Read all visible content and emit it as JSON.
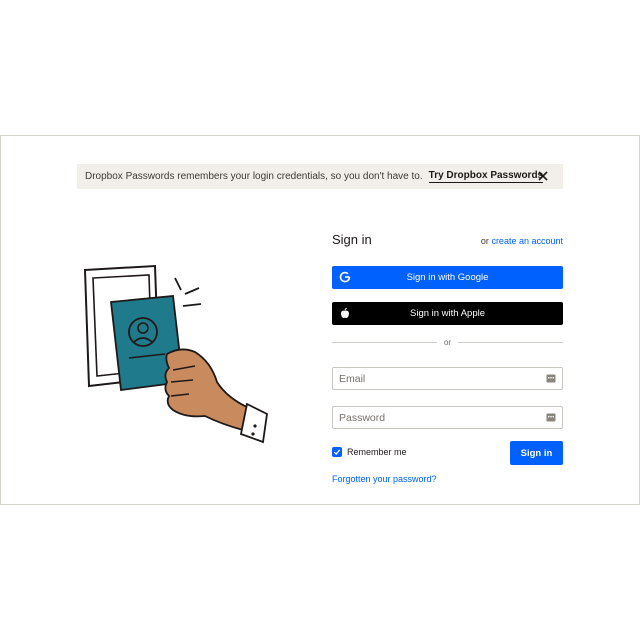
{
  "banner": {
    "message": "Dropbox Passwords remembers your login credentials, so you don't have to.",
    "cta": "Try Dropbox Passwords"
  },
  "form": {
    "title": "Sign in",
    "alt_prefix": "or",
    "create_account": "create an account",
    "google": "Sign in with Google",
    "apple": "Sign in with Apple",
    "divider": "or",
    "email_placeholder": "Email",
    "password_placeholder": "Password",
    "remember": "Remember me",
    "remember_checked": true,
    "signin": "Sign in",
    "forgot": "Forgotten your password?"
  },
  "colors": {
    "accent": "#0061fe",
    "banner_bg": "#f2efea",
    "card": "#1f7a8c",
    "skin": "#c98a5e"
  }
}
